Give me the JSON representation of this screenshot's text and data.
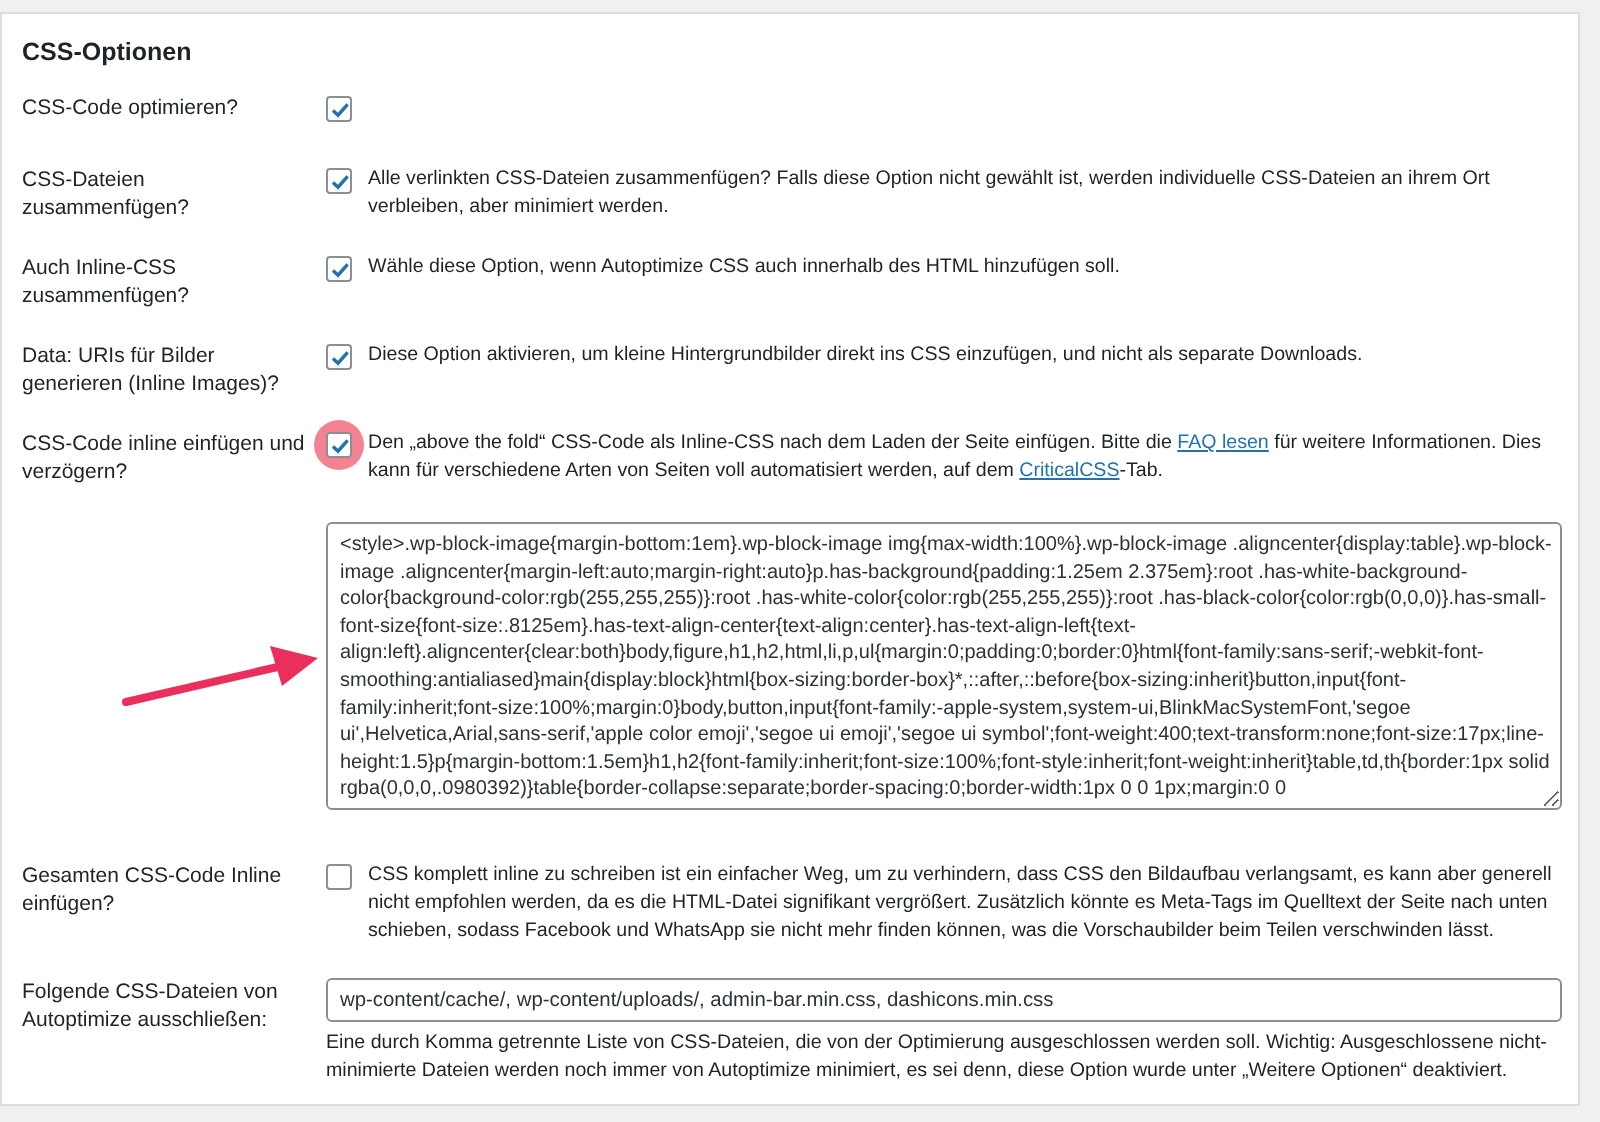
{
  "section_title": "CSS-Optionen",
  "rows": [
    {
      "kind": "checkbox",
      "label": "CSS-Code optimieren?",
      "checked": true,
      "highlighted": false
    },
    {
      "kind": "checkbox",
      "label": "CSS-Dateien zusammenfügen?",
      "checked": true,
      "highlighted": false,
      "description": [
        {
          "kind": "text",
          "text": "Alle verlinkten CSS-Dateien zusammenfügen? Falls diese Option nicht gewählt ist, werden individuelle CSS-Dateien an ihrem Ort verbleiben, aber minimiert werden."
        }
      ]
    },
    {
      "kind": "checkbox",
      "label": "Auch Inline-CSS zusammenfügen?",
      "checked": true,
      "highlighted": false,
      "description": [
        {
          "kind": "text",
          "text": "Wähle diese Option, wenn Autoptimize CSS auch innerhalb des HTML hinzufügen soll."
        }
      ]
    },
    {
      "kind": "checkbox",
      "label": "Data: URIs für Bilder generieren (Inline Images)?",
      "checked": true,
      "highlighted": false,
      "description": [
        {
          "kind": "text",
          "text": "Diese Option aktivieren, um kleine Hintergrundbilder direkt ins CSS einzufügen, und nicht als separate Downloads."
        }
      ]
    },
    {
      "kind": "checkbox",
      "label": "CSS-Code inline einfügen und verzögern?",
      "checked": true,
      "highlighted": true,
      "description": [
        {
          "kind": "text",
          "text": "Den „above the fold“ CSS-Code als Inline-CSS nach dem Laden der Seite einfügen. Bitte die "
        },
        {
          "kind": "link",
          "text": "FAQ lesen"
        },
        {
          "kind": "text",
          "text": " für weitere Informationen. Dies kann für verschiedene Arten von Seiten voll automatisiert werden, auf dem "
        },
        {
          "kind": "link",
          "text": "CriticalCSS"
        },
        {
          "kind": "text",
          "text": "-Tab."
        }
      ],
      "code": "<style>.wp-block-image{margin-bottom:1em}.wp-block-image img{max-width:100%}.wp-block-image .aligncenter{display:table}.wp-block-image .aligncenter{margin-left:auto;margin-right:auto}p.has-background{padding:1.25em 2.375em}:root .has-white-background-color{background-color:rgb(255,255,255)}:root .has-white-color{color:rgb(255,255,255)}:root .has-black-color{color:rgb(0,0,0)}.has-small-font-size{font-size:.8125em}.has-text-align-center{text-align:center}.has-text-align-left{text-align:left}.aligncenter{clear:both}body,figure,h1,h2,html,li,p,ul{margin:0;padding:0;border:0}html{font-family:sans-serif;-webkit-font-smoothing:antialiased}main{display:block}html{box-sizing:border-box}*,::after,::before{box-sizing:inherit}button,input{font-family:inherit;font-size:100%;margin:0}body,button,input{font-family:-apple-system,system-ui,BlinkMacSystemFont,'segoe ui',Helvetica,Arial,sans-serif,'apple color emoji','segoe ui emoji','segoe ui symbol';font-weight:400;text-transform:none;font-size:17px;line-height:1.5}p{margin-bottom:1.5em}h1,h2{font-family:inherit;font-size:100%;font-style:inherit;font-weight:inherit}table,td,th{border:1px solid rgba(0,0,0,.0980392)}table{border-collapse:separate;border-spacing:0;border-width:1px 0 0 1px;margin:0 0",
      "pointer_arrow": true
    },
    {
      "kind": "checkbox",
      "label": "Gesamten CSS-Code Inline einfügen?",
      "checked": false,
      "highlighted": false,
      "description": [
        {
          "kind": "text",
          "text": "CSS komplett inline zu schreiben ist ein einfacher Weg, um zu verhindern, dass CSS den Bildaufbau verlangsamt, es kann aber generell nicht empfohlen werden, da es die HTML-Datei signifikant vergrößert. Zusätzlich könnte es Meta-Tags im Quelltext der Seite nach unten schieben, sodass Facebook und WhatsApp sie nicht mehr finden können, was die Vorschaubilder beim Teilen verschwinden lässt."
        }
      ]
    },
    {
      "kind": "text",
      "label": "Folgende CSS-Dateien von Autoptimize ausschließen:",
      "value": "wp-content/cache/, wp-content/uploads/, admin-bar.min.css, dashicons.min.css",
      "description": [
        {
          "kind": "text",
          "text": "Eine durch Komma getrennte Liste von CSS-Dateien, die von der Optimierung ausgeschlossen werden soll. Wichtig: Ausgeschlossene nicht-minimierte Dateien werden noch immer von Autoptimize minimiert, es sei denn, diese Option wurde unter „Weitere Optionen“ deaktiviert."
        }
      ]
    }
  ]
}
